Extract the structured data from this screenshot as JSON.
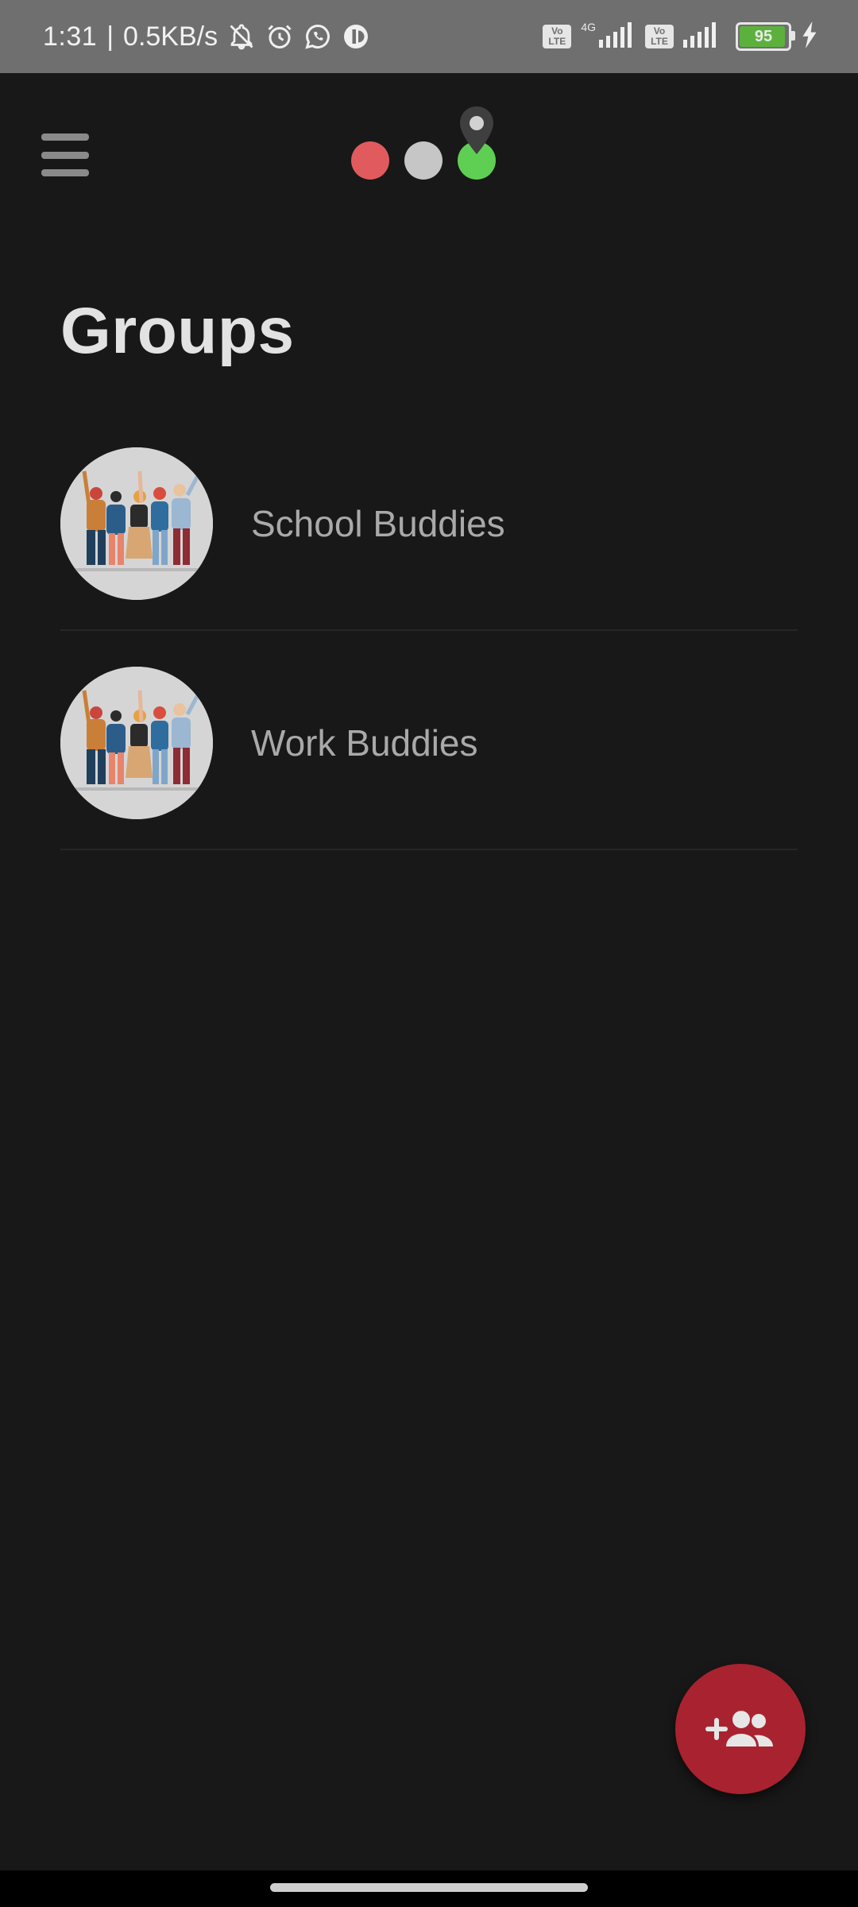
{
  "status_bar": {
    "time": "1:31",
    "separator": "|",
    "speed": "0.5KB/s",
    "icons": [
      "bell-off-icon",
      "alarm-icon",
      "whatsapp-icon",
      "app-icon"
    ],
    "sim1_label_top": "Vo",
    "sim1_label_bottom": "LTE",
    "network_type": "4G",
    "sim2_label_top": "Vo",
    "sim2_label_bottom": "LTE",
    "battery_level": "95",
    "battery_fraction": 0.95,
    "charging": true
  },
  "app_bar": {
    "menu_icon": "hamburger-menu-icon",
    "logo_icon": "traffic-dots-location-pin-logo"
  },
  "page": {
    "title": "Groups"
  },
  "groups": [
    {
      "name": "School Buddies",
      "avatar": "group-people-illustration"
    },
    {
      "name": "Work Buddies",
      "avatar": "group-people-illustration"
    }
  ],
  "fab": {
    "icon": "add-group-icon",
    "color": "#a8232f"
  },
  "colors": {
    "background": "#181818",
    "status_bar": "#6f6f6f",
    "logo_red": "#e15b5e",
    "logo_grey": "#c6c6c6",
    "logo_green": "#5fcf53",
    "battery_green": "#5cb13d"
  }
}
